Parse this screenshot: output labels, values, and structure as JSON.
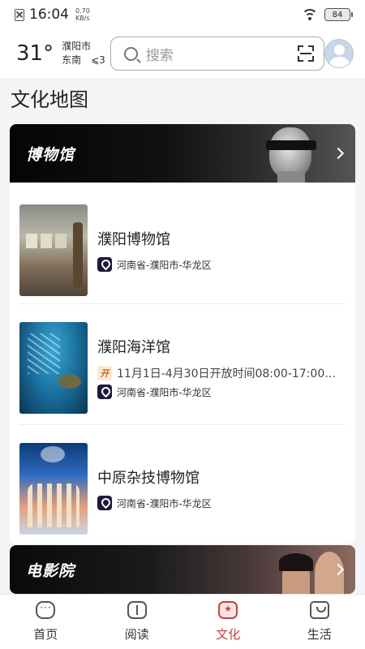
{
  "status_bar": {
    "time": "16:04",
    "speed_value": "0.70",
    "speed_unit": "KB/s",
    "battery": "84"
  },
  "header": {
    "temperature": "31°",
    "city": "濮阳市",
    "wind_direction": "东南",
    "wind_level": "⩽3",
    "search_placeholder": "搜索"
  },
  "page_title": "文化地图",
  "museum_section": {
    "title": "博物馆",
    "items": [
      {
        "name": "濮阳博物馆",
        "location": "河南省-濮阳市-华龙区"
      },
      {
        "name": "濮阳海洋馆",
        "hours": "11月1日-4月30日开放时间08:00-17:00…",
        "open_icon": "开",
        "location": "河南省-濮阳市-华龙区"
      },
      {
        "name": "中原杂技博物馆",
        "location": "河南省-濮阳市-华龙区"
      }
    ]
  },
  "cinema_section": {
    "title": "电影院"
  },
  "tabs": [
    {
      "label": "首页",
      "icon": "home-icon"
    },
    {
      "label": "阅读",
      "icon": "book-icon"
    },
    {
      "label": "文化",
      "icon": "culture-icon",
      "active": true
    },
    {
      "label": "生活",
      "icon": "life-icon"
    }
  ],
  "colors": {
    "accent": "#c2443f",
    "location_badge": "#1f1a3b"
  }
}
